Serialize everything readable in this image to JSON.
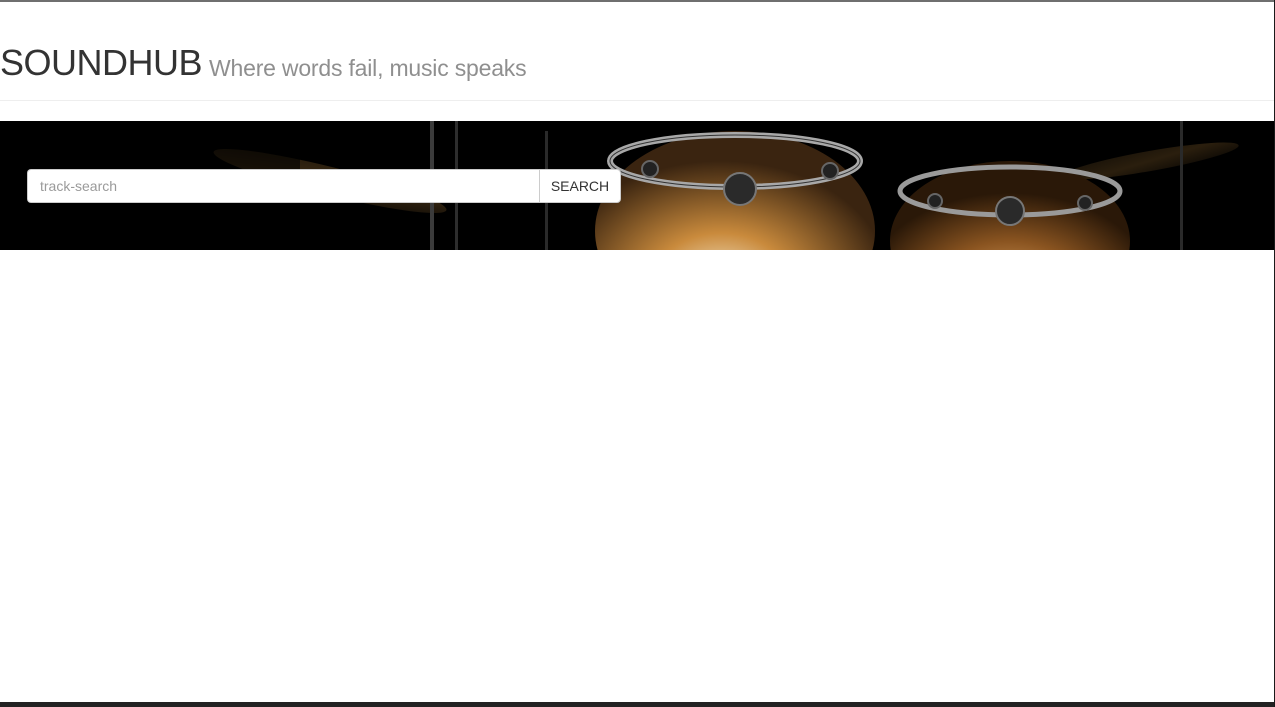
{
  "header": {
    "brand": "SOUNDHUB",
    "tagline": "Where words fail, music speaks"
  },
  "hero": {
    "background_image": "drum-kit-photo"
  },
  "search": {
    "placeholder": "track-search",
    "value": "",
    "button_label": "SEARCH"
  },
  "colors": {
    "brand_text": "#333333",
    "tagline_text": "#8f8f8f",
    "hero_background": "#000000"
  }
}
